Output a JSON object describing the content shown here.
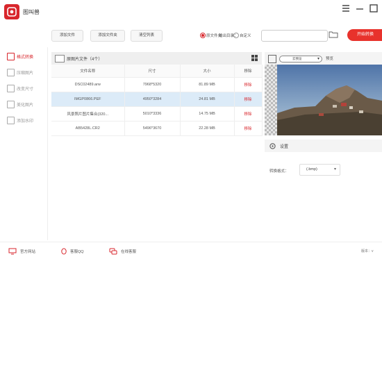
{
  "app": {
    "name": "图叫兽"
  },
  "sidebar": {
    "items": [
      {
        "label": "格式转换",
        "active": true
      },
      {
        "label": "压缩图片",
        "active": false
      },
      {
        "label": "改变尺寸",
        "active": false
      },
      {
        "label": "美化图片",
        "active": false
      },
      {
        "label": "添加水印",
        "active": false
      }
    ]
  },
  "toolbar": {
    "add_file": "添加文件",
    "add_folder": "添加文件夹",
    "clear_list": "清空列表",
    "output_label": "输出目录：",
    "option_original": "原文件夹",
    "option_custom": "自定义",
    "path_value": "",
    "start_label": "开始转换"
  },
  "file_panel": {
    "title": "原图片文件（4个）",
    "columns": [
      "文件名称",
      "尺寸",
      "大小",
      "移除"
    ],
    "rows": [
      {
        "name": "DSC02489.arw",
        "size": "7968*5320",
        "filesize": "81.89 MB",
        "action": "移除",
        "selected": false
      },
      {
        "name": "IMGP0866.PEF",
        "size": "4950*3284",
        "filesize": "24.81 MB",
        "action": "移除",
        "selected": true
      },
      {
        "name": "风景照片图片集合(320...",
        "size": "5010*3336",
        "filesize": "14.75 MB",
        "action": "移除",
        "selected": false
      },
      {
        "name": "AB5428L.CR2",
        "size": "5496*3670",
        "filesize": "22.28 MB",
        "action": "移除",
        "selected": false
      }
    ]
  },
  "preview": {
    "select_value": "云预览",
    "label": "预览"
  },
  "settings": {
    "title": "设置",
    "format_label": "转换格式：",
    "format_value": "(.bmp)"
  },
  "footer": {
    "items": [
      "官方网站",
      "客服QQ",
      "在线客服"
    ],
    "version": "版本：v"
  },
  "colors": {
    "accent": "#d8262c",
    "start_button": "#e8322c",
    "selected_row": "#dcebf8"
  }
}
